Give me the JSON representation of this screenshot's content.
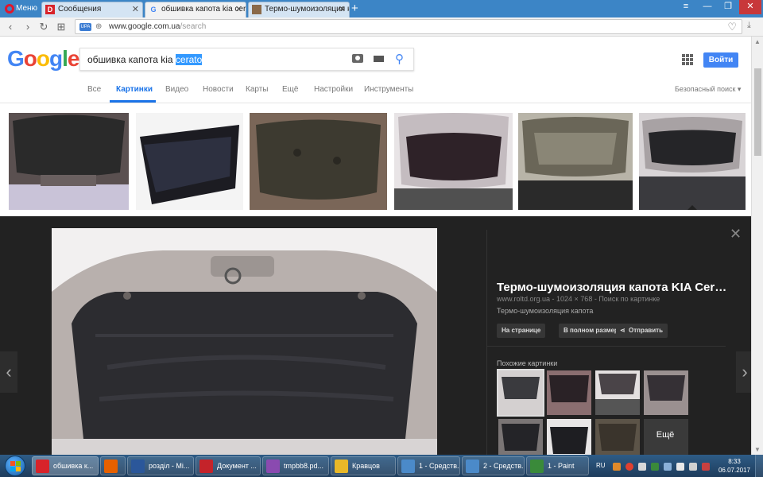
{
  "browser": {
    "menu_label": "Меню",
    "tabs": [
      {
        "label": "Сообщения",
        "icon": "drive2-icon"
      },
      {
        "label": "обшивка капота kia cerato",
        "icon": "google-icon"
      },
      {
        "label": "Термо-шумоизоляция ка",
        "icon": "image-tab-icon"
      }
    ],
    "new_tab": "+",
    "address": {
      "badge": "UPA",
      "domain": "www.google.com.ua",
      "path": "/search"
    }
  },
  "google": {
    "logo_letters": [
      "G",
      "o",
      "o",
      "g",
      "l",
      "e"
    ],
    "query_plain": "обшивка капота kia ",
    "query_selected": "cerato",
    "signin_label": "Войти",
    "tabs": [
      "Все",
      "Картинки",
      "Видео",
      "Новости",
      "Карты",
      "Ещё",
      "Настройки",
      "Инструменты"
    ],
    "active_tab": "Картинки",
    "safe_search": "Безопасный поиск ▾"
  },
  "preview": {
    "title": "Термо-шумоизоляция капота KIA Cer…",
    "meta": "www.roltd.org.ua  -  1024 × 768  -  Поиск по картинке",
    "description": "Термо-шумоизоляция капота",
    "buttons": [
      "На странице",
      "В полном размере",
      "Отправить"
    ],
    "similar_label": "Похожие картинки",
    "more_label": "Ещё"
  },
  "taskbar": {
    "items": [
      {
        "label": "обшивка к...",
        "icon": "opera-icon",
        "color": "#d8232a"
      },
      {
        "label": "",
        "icon": "firefox-icon",
        "color": "#e66000"
      },
      {
        "label": "розділ - Mi...",
        "icon": "word-icon",
        "color": "#2b579a"
      },
      {
        "label": "Документ ...",
        "icon": "reader-icon",
        "color": "#c4232a"
      },
      {
        "label": "tmpbb8.pd...",
        "icon": "pdf-icon",
        "color": "#8a4ab0"
      },
      {
        "label": "Кравцов",
        "icon": "folder-icon",
        "color": "#e8b828"
      },
      {
        "label": "1 - Средств...",
        "icon": "window-icon",
        "color": "#4b8ac9"
      },
      {
        "label": "2 - Средств...",
        "icon": "window-icon",
        "color": "#4b8ac9"
      },
      {
        "label": "1 - Paint",
        "icon": "paint-icon",
        "color": "#3a8a3a"
      }
    ],
    "lang": "RU",
    "time": "8:33",
    "date": "06.07.2017"
  }
}
